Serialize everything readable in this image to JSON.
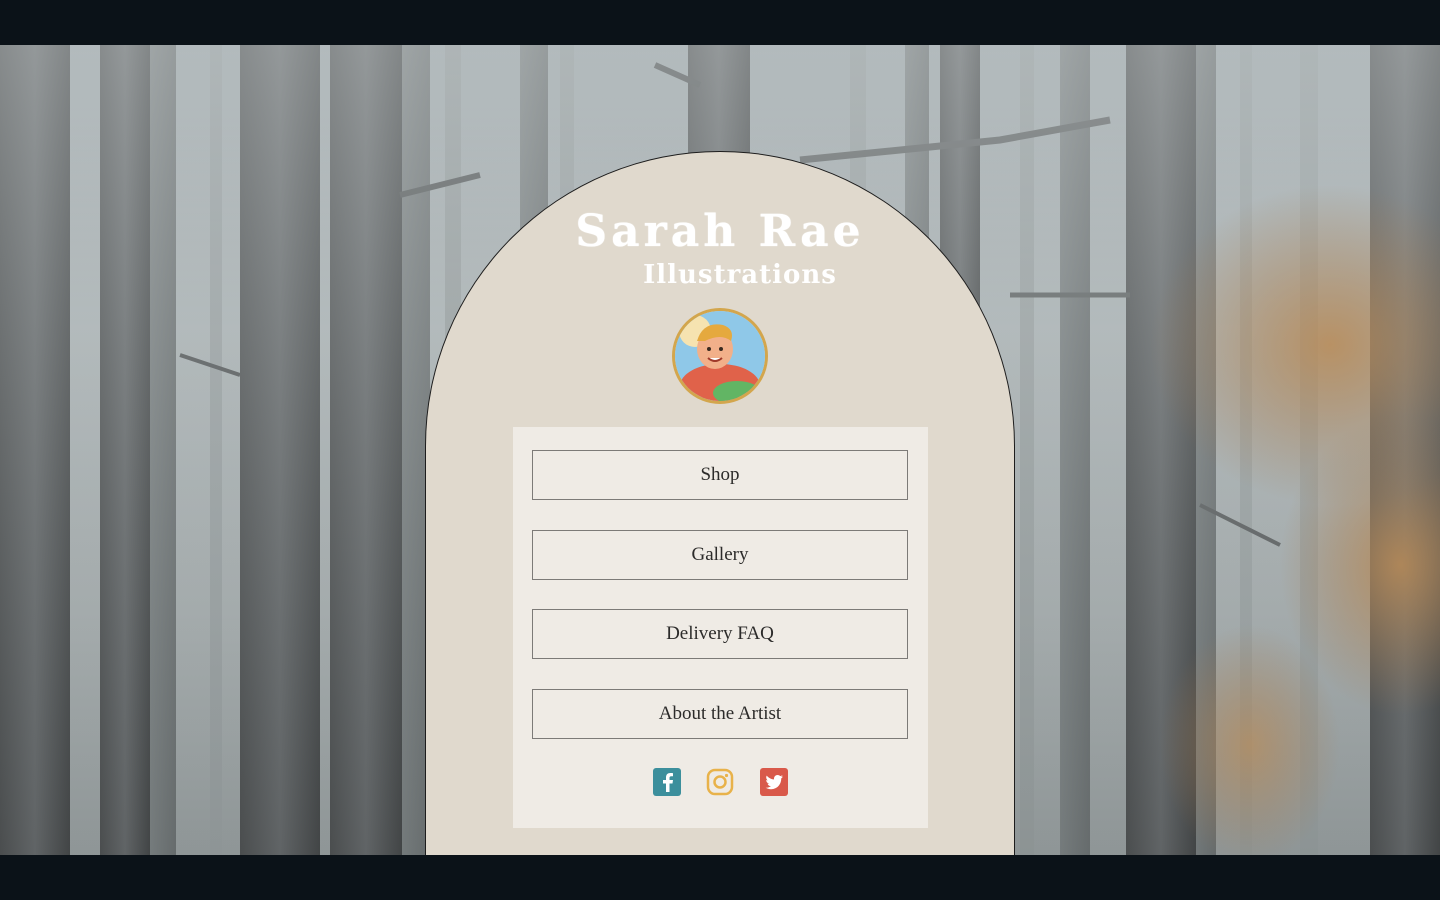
{
  "brand": {
    "line1": "Sarah Rae",
    "line2": "Illustrations"
  },
  "avatar": {
    "icon": "illustrated-portrait-avatar"
  },
  "links": [
    {
      "label": "Shop"
    },
    {
      "label": "Gallery"
    },
    {
      "label": "Delivery FAQ"
    },
    {
      "label": "About the Artist"
    }
  ],
  "social": [
    {
      "icon": "facebook-icon",
      "color": "#3c8f9c"
    },
    {
      "icon": "instagram-icon",
      "color": "#e8b24a"
    },
    {
      "icon": "twitter-icon",
      "color": "#d9594a"
    }
  ],
  "colors": {
    "arch": "#e0d9cd",
    "panel": "#efebe5",
    "letterbox": "#0b1218"
  }
}
